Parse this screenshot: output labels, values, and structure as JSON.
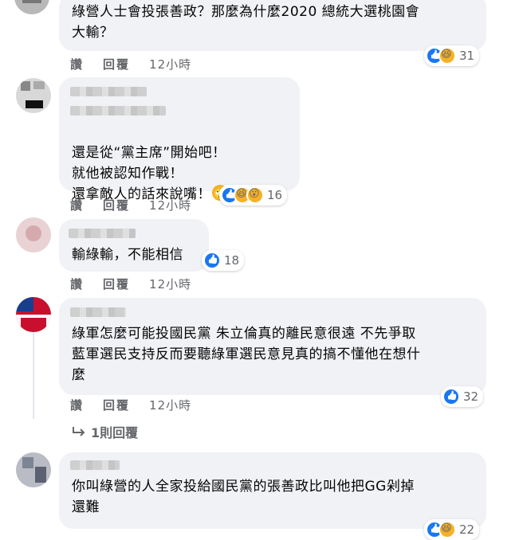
{
  "comments": [
    {
      "text": "綠營人士會投張善政？那麼為什麼2020 總統大選桃園會\n大輸？",
      "actions": {
        "like": "讚",
        "reply": "回覆",
        "time": "12小時"
      },
      "reactions": {
        "count": "31",
        "types": [
          "like",
          "haha"
        ]
      }
    },
    {
      "text": "還是從“黨主席”開始吧！\n就他被認知作戰！\n還拿敵人的話來說嘴！",
      "actions": {
        "like": "讚",
        "reply": "回覆",
        "time": "12小時"
      },
      "reactions": {
        "count": "16",
        "types": [
          "like",
          "haha",
          "wow"
        ]
      }
    },
    {
      "text": "輸綠輸，不能相信",
      "actions": {
        "like": "讚",
        "reply": "回覆",
        "time": "12小時"
      },
      "reactions": {
        "count": "18",
        "types": [
          "like"
        ]
      }
    },
    {
      "text": "綠軍怎麼可能投國民黨 朱立倫真的離民意很遠 不先爭取\n藍軍選民支持反而要聽綠軍選民意見真的搞不懂他在想什\n麼",
      "actions": {
        "like": "讚",
        "reply": "回覆",
        "time": "12小時"
      },
      "reactions": {
        "count": "32",
        "types": [
          "like"
        ]
      },
      "replies_link": "1則回覆"
    },
    {
      "text": "你叫綠營的人全家投給國民黨的張善政比叫他把GG剁掉\n還難",
      "reactions": {
        "count": "22",
        "types": [
          "like",
          "haha"
        ]
      }
    }
  ],
  "icons": {
    "reply_arrow": "reply-arrow-icon"
  },
  "colors": {
    "bubble": "#f0f2f5",
    "meta": "#65676b",
    "like": "#1877f2",
    "haha": "#f7b125"
  }
}
